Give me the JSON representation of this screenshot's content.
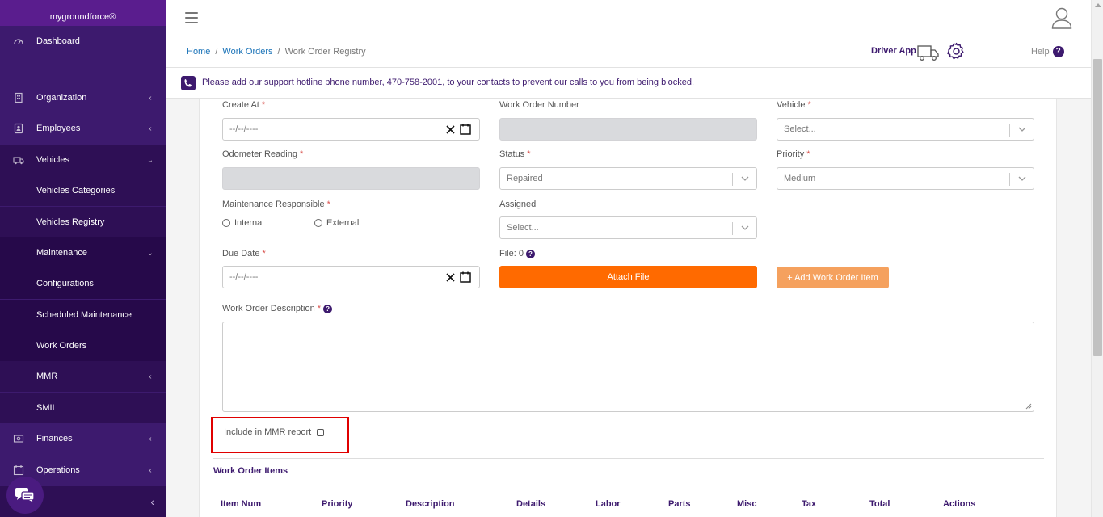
{
  "app": {
    "brand": "mygroundforce®"
  },
  "sidebar": {
    "items": [
      {
        "label": "Dashboard",
        "icon": "dashboard-icon",
        "chevron": ""
      },
      {
        "label": "Organization",
        "icon": "building-icon",
        "chevron": "‹"
      },
      {
        "label": "Employees",
        "icon": "id-card-icon",
        "chevron": "‹"
      },
      {
        "label": "Vehicles",
        "icon": "truck-icon",
        "chevron": "⌄"
      },
      {
        "label": "Vehicles Categories"
      },
      {
        "label": "Vehicles Registry"
      },
      {
        "label": "Maintenance",
        "chevron": "⌄"
      },
      {
        "label": "Configurations"
      },
      {
        "label": "Scheduled Maintenance"
      },
      {
        "label": "Work Orders"
      },
      {
        "label": "MMR",
        "chevron": "‹"
      },
      {
        "label": "SMII"
      },
      {
        "label": "Finances",
        "icon": "finance-icon",
        "chevron": "‹"
      },
      {
        "label": "Operations",
        "icon": "calendar-icon",
        "chevron": "‹"
      }
    ],
    "collapse_glyph": "‹"
  },
  "breadcrumb": {
    "home": "Home",
    "work_orders": "Work Orders",
    "current": "Work Order Registry",
    "sep": "/"
  },
  "header": {
    "driver_app": "Driver App",
    "help": "Help",
    "help_glyph": "?"
  },
  "notice": {
    "text": "Please add our support hotline phone number, 470-758-2001, to your contacts to prevent our calls to you from being blocked."
  },
  "form": {
    "create_at": {
      "label": "Create At",
      "req": "*",
      "value": "--/--/----"
    },
    "work_order_number": {
      "label": "Work Order Number",
      "value": ""
    },
    "vehicle": {
      "label": "Vehicle",
      "req": "*",
      "value": "Select..."
    },
    "odometer": {
      "label": "Odometer Reading",
      "req": "*",
      "value": ""
    },
    "status": {
      "label": "Status",
      "req": "*",
      "value": "Repaired"
    },
    "priority": {
      "label": "Priority",
      "req": "*",
      "value": "Medium"
    },
    "maintenance_responsible": {
      "label": "Maintenance Responsible",
      "req": "*",
      "options": [
        "Internal",
        "External"
      ]
    },
    "assigned": {
      "label": "Assigned",
      "value": "Select..."
    },
    "due_date": {
      "label": "Due Date",
      "req": "*",
      "value": "--/--/----"
    },
    "file": {
      "label": "File: 0"
    },
    "attach_button": "Attach File",
    "add_item_button": "+ Add Work Order Item",
    "description": {
      "label": "Work Order Description",
      "req": "*",
      "value": ""
    },
    "mmr": {
      "label": "Include in MMR report",
      "checked": false
    }
  },
  "items_table": {
    "title": "Work Order Items",
    "columns": [
      "Item Num",
      "Priority",
      "Description",
      "Details",
      "Labor",
      "Parts",
      "Misc",
      "Tax",
      "Total",
      "Actions"
    ]
  },
  "colors": {
    "sidebar": "#3d1a6e",
    "brand": "#5a1d8e",
    "accent": "#ff6a00",
    "accent_light": "#f5a15e",
    "link": "#1a73b8",
    "highlight": "#e00000"
  }
}
